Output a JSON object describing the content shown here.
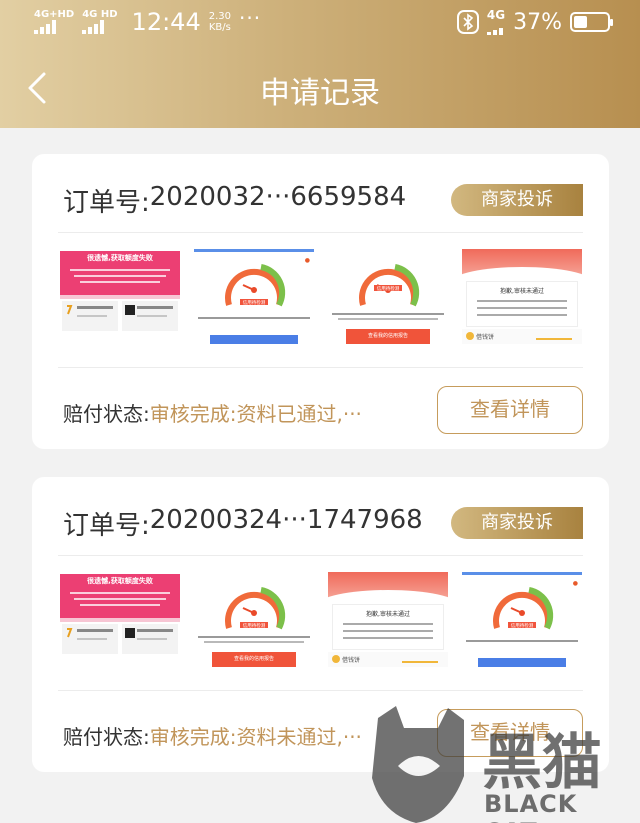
{
  "status_bar": {
    "net1": "4G+HD",
    "net2": "4G HD",
    "time": "12:44",
    "speed_value": "2.30",
    "speed_unit": "KB/s",
    "more": "···",
    "net_right": "4G",
    "battery": "37%"
  },
  "header": {
    "title": "申请记录"
  },
  "orders": [
    {
      "order_label": "订单号:",
      "order_no": "2020032···6659584",
      "complain_label": "商家投诉",
      "status_label": "赔付状态:",
      "status_value": "审核完成:资料已通过,···",
      "detail_label": "查看详情",
      "thumbs": {
        "t1_title": "很遗憾,获取额度失败",
        "t2_gauge": "信用待检测",
        "t3_gauge": "信用待检测",
        "t3_button": "查看我的信用报告",
        "t4_title": "抱歉,审核未通过",
        "t4_footer": "借钱饼"
      }
    },
    {
      "order_label": "订单号:",
      "order_no": "20200324···1747968",
      "complain_label": "商家投诉",
      "status_label": "赔付状态:",
      "status_value": "审核完成:资料未通过,···",
      "detail_label": "查看详情",
      "thumbs": {
        "t1_title": "很遗憾,获取额度失败",
        "t2_gauge": "信用待检测",
        "t2_button": "查看我的信用报告",
        "t3_title": "抱歉,审核未通过",
        "t3_footer": "借钱饼",
        "t4_gauge": "信用待检测"
      }
    }
  ],
  "watermark": {
    "cn": "黑猫",
    "en": "BLACK CAT"
  },
  "colors": {
    "header_start": "#e2cfa3",
    "header_end": "#b78f50",
    "accent_gold": "#c1955a",
    "failure_pink": "#ec3f73",
    "gauge_red": "#f0543a",
    "gauge_blue": "#4a7ee6"
  },
  "icons": {
    "back": "chevron-left-icon",
    "bluetooth": "bluetooth-icon",
    "battery": "battery-icon",
    "signal": "signal-icon"
  }
}
